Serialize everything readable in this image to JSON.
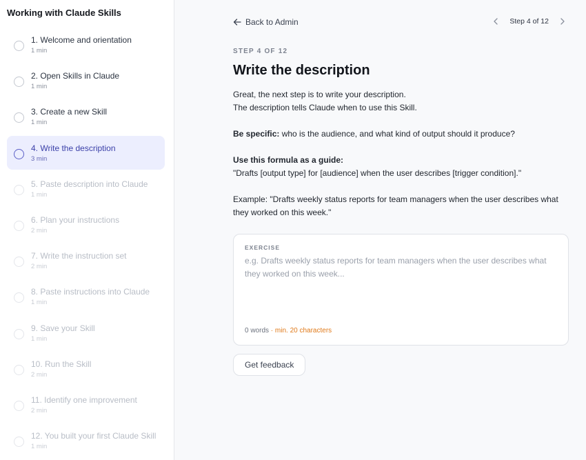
{
  "sidebar": {
    "title": "Working with Claude Skills",
    "steps": [
      {
        "label": "1. Welcome and orientation",
        "duration": "1 min"
      },
      {
        "label": "2. Open Skills in Claude",
        "duration": "1 min"
      },
      {
        "label": "3. Create a new Skill",
        "duration": "1 min"
      },
      {
        "label": "4. Write the description",
        "duration": "3 min"
      },
      {
        "label": "5. Paste description into Claude",
        "duration": "1 min"
      },
      {
        "label": "6. Plan your instructions",
        "duration": "2 min"
      },
      {
        "label": "7. Write the instruction set",
        "duration": "2 min"
      },
      {
        "label": "8. Paste instructions into Claude",
        "duration": "1 min"
      },
      {
        "label": "9. Save your Skill",
        "duration": "1 min"
      },
      {
        "label": "10. Run the Skill",
        "duration": "2 min"
      },
      {
        "label": "11. Identify one improvement",
        "duration": "2 min"
      },
      {
        "label": "12. You built your first Claude Skill",
        "duration": "1 min"
      }
    ]
  },
  "header": {
    "back_label": "Back to Admin",
    "step_indicator": "Step 4 of 12"
  },
  "content": {
    "eyebrow": "STEP 4 OF 12",
    "title": "Write the description",
    "intro_line1": "Great, the next step is to write your description.",
    "intro_line2": "The description tells Claude when to use this Skill.",
    "specific_bold": "Be specific:",
    "specific_text": " who is the audience, and what kind of output should it produce?",
    "formula_bold": "Use this formula as a guide:",
    "formula_text": "\"Drafts [output type] for [audience] when the user describes [trigger condition].\"",
    "example_text": "Example: \"Drafts weekly status reports for team managers when the user describes what they worked on this week.\""
  },
  "exercise": {
    "label": "EXERCISE",
    "value": "",
    "placeholder": "e.g. Drafts weekly status reports for team managers when the user describes what they worked on this week...",
    "word_count": "0 words",
    "min_note": "· min. 20 characters"
  },
  "actions": {
    "feedback_label": "Get feedback"
  },
  "colors": {
    "accent": "#5b5fc7",
    "active_bg": "#eceefe",
    "warning": "#e07a1a"
  },
  "icons": {
    "back": "arrow-left-icon",
    "prev": "chevron-left-icon",
    "next": "chevron-right-icon",
    "step_status": "circle-icon"
  }
}
